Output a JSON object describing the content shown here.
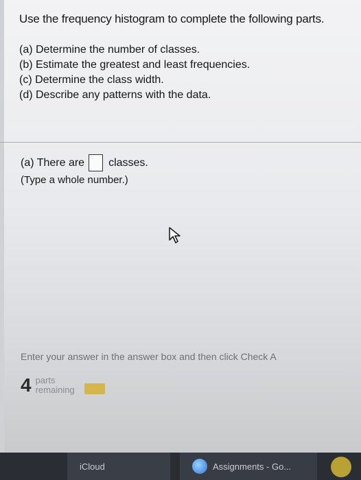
{
  "question": {
    "prompt": "Use the frequency histogram to complete the following parts.",
    "parts": [
      "(a) Determine the number of classes.",
      "(b) Estimate the greatest and least frequencies.",
      "(c) Determine the class width.",
      "(d) Describe any patterns with the data."
    ]
  },
  "answer": {
    "prefix": "(a) There are",
    "suffix": "classes.",
    "value": "",
    "hint": "(Type a whole number.)"
  },
  "status": {
    "instruction": "Enter your answer in the answer box and then click Check A",
    "parts_count": "4",
    "parts_line1": "parts",
    "parts_line2": "remaining"
  },
  "taskbar": {
    "items": [
      "iCloud",
      "Assignments - Go..."
    ]
  },
  "colors": {
    "progress": "#d6b44f",
    "taskbar": "#2a2d33"
  },
  "icons": [
    "mouse-cursor-icon",
    "browser-app-icon",
    "app-corner-icon"
  ]
}
